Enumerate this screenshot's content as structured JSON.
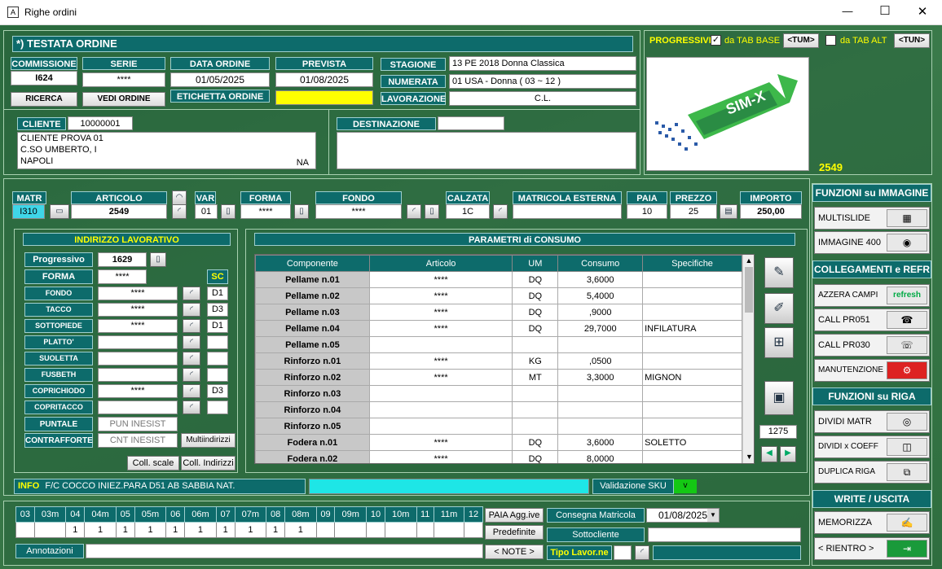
{
  "window": {
    "title": "Righe ordini",
    "minimize": "—",
    "maximize": "☐",
    "close": "✕"
  },
  "testata": {
    "title": "*) TESTATA ORDINE",
    "commissione_label": "COMMISSIONE",
    "commissione": "I624",
    "serie_label": "SERIE",
    "serie": "****",
    "data_label": "DATA ORDINE",
    "data": "01/05/2025",
    "prevista_label": "PREVISTA CONSEGNA",
    "prevista": "01/08/2025",
    "etichetta_label": "ETICHETTA ORDINE",
    "stagione_label": "STAGIONE",
    "stagione": "13  PE 2018 Donna Classica",
    "numerata_label": "NUMERATA",
    "numerata": "01  USA - Donna ( 03 ~ 12 )",
    "lavorazione_label": "LAVORAZIONE",
    "lavorazione": "C.L.",
    "ricerca": "RICERCA",
    "vedi": "VEDI ORDINE",
    "cliente_label": "CLIENTE",
    "cliente_code": "10000001",
    "cliente_line1": "CLIENTE PROVA 01",
    "cliente_line2": "C.SO UMBERTO, I",
    "cliente_line3": "NAPOLI",
    "cliente_prov": "NA",
    "dest_label": "DESTINAZIONE MERCE"
  },
  "progressivi": {
    "label": "PROGRESSIVI",
    "base": "da TAB BASE",
    "base_btn": "<TUM>",
    "alt": "da TAB ALT",
    "alt_btn": "<TUN>",
    "logo": "SIM-X",
    "number": "2549"
  },
  "riga": {
    "matr_label": "MATR",
    "matr": "I310",
    "articolo_label": "ARTICOLO",
    "articolo": "2549",
    "var_label": "VAR",
    "var": "01",
    "forma_label": "FORMA",
    "forma": "****",
    "fondo_label": "FONDO",
    "fondo": "****",
    "calzata_label": "CALZATA",
    "calzata": "1C",
    "matest_label": "MATRICOLA ESTERNA",
    "paia_label": "PAIA",
    "paia": "10",
    "prezzo_label": "PREZZO",
    "prezzo": "25",
    "importo_label": "IMPORTO",
    "importo": "250,00"
  },
  "indirizzo": {
    "title": "INDIRIZZO LAVORATIVO",
    "progressivo_label": "Progressivo",
    "progressivo": "1629",
    "forma_label": "FORMA",
    "forma": "****",
    "sc": "SC",
    "rows": [
      {
        "l": "FONDO",
        "v": "****",
        "s": "D1"
      },
      {
        "l": "TACCO",
        "v": "****",
        "s": "D3"
      },
      {
        "l": "SOTTOPIEDE",
        "v": "****",
        "s": "D1"
      },
      {
        "l": "PLATTO'",
        "v": "",
        "s": ""
      },
      {
        "l": "SUOLETTA",
        "v": "",
        "s": ""
      },
      {
        "l": "FUSBETH",
        "v": "",
        "s": ""
      },
      {
        "l": "COPRICHIODO",
        "v": "****",
        "s": "D3"
      },
      {
        "l": "COPRITACCO",
        "v": "",
        "s": ""
      }
    ],
    "puntale_label": "PUNTALE",
    "puntale": "PUN INESIST",
    "contrafforte_label": "CONTRAFFORTE",
    "contrafforte": "CNT INESIST",
    "multi": "Multiindirizzi",
    "coll_scale": "Coll. scale",
    "coll_indirizzi": "Coll. Indirizzi"
  },
  "parametri": {
    "title": "PARAMETRI di CONSUMO",
    "headers": [
      "Componente",
      "Articolo",
      "UM",
      "Consumo",
      "Specifiche"
    ],
    "rows": [
      [
        "Pellame n.01",
        "****",
        "DQ",
        "3,6000",
        ""
      ],
      [
        "Pellame n.02",
        "****",
        "DQ",
        "5,4000",
        ""
      ],
      [
        "Pellame n.03",
        "****",
        "DQ",
        ",9000",
        ""
      ],
      [
        "Pellame n.04",
        "****",
        "DQ",
        "29,7000",
        "INFILATURA"
      ],
      [
        "Pellame n.05",
        "",
        "",
        "",
        ""
      ],
      [
        "Rinforzo n.01",
        "****",
        "KG",
        ",0500",
        ""
      ],
      [
        "Rinforzo n.02",
        "****",
        "MT",
        "3,3000",
        "MIGNON"
      ],
      [
        "Rinforzo n.03",
        "",
        "",
        "",
        ""
      ],
      [
        "Rinforzo n.04",
        "",
        "",
        "",
        ""
      ],
      [
        "Rinforzo n.05",
        "",
        "",
        "",
        ""
      ],
      [
        "Fodera n.01",
        "****",
        "DQ",
        "3,6000",
        "SOLETTO"
      ],
      [
        "Fodera n.02",
        "****",
        "DQ",
        "8,0000",
        ""
      ]
    ],
    "counter": "1275"
  },
  "info": {
    "label": "INFO",
    "text": "F/C COCCO INIEZ.PARA D51 AB SABBIA NAT.",
    "validazione": "Validazione SKU",
    "v": "v"
  },
  "sizes": {
    "headers": [
      "03",
      "03m",
      "04",
      "04m",
      "05",
      "05m",
      "06",
      "06m",
      "07",
      "07m",
      "08",
      "08m",
      "09",
      "09m",
      "10",
      "10m",
      "11",
      "11m",
      "12"
    ],
    "values": [
      "",
      "",
      "1",
      "1",
      "1",
      "1",
      "1",
      "1",
      "1",
      "1",
      "1",
      "1",
      "",
      "",
      "",
      "",
      "",
      "",
      ""
    ],
    "paia_agg": "PAIA Agg.ive",
    "predefinite": "Predefinite",
    "annotazioni": "Annotazioni",
    "note": "< NOTE >",
    "consegna_label": "Consegna Matricola",
    "consegna": "01/08/2025",
    "sottocliente": "Sottocliente",
    "tipo_lavor": "Tipo Lavor.ne"
  },
  "right": {
    "funz_imm": "FUNZIONI su IMMAGINE",
    "multislide": "MULTISLIDE",
    "immagine400": "IMMAGINE 400",
    "collegamenti": "COLLEGAMENTI e REFR",
    "azzera": "AZZERA CAMPI",
    "refresh": "refresh",
    "call051": "CALL PR051",
    "call030": "CALL PR030",
    "manutenzione": "MANUTENZIONE",
    "funz_riga": "FUNZIONI su RIGA",
    "dividi_matr": "DIVIDI MATR",
    "dividi_coeff": "DIVIDI x COEFF",
    "duplica": "DUPLICA RIGA",
    "write": "WRITE / USCITA",
    "memorizza": "MEMORIZZA",
    "rientro": "< RIENTRO >"
  }
}
